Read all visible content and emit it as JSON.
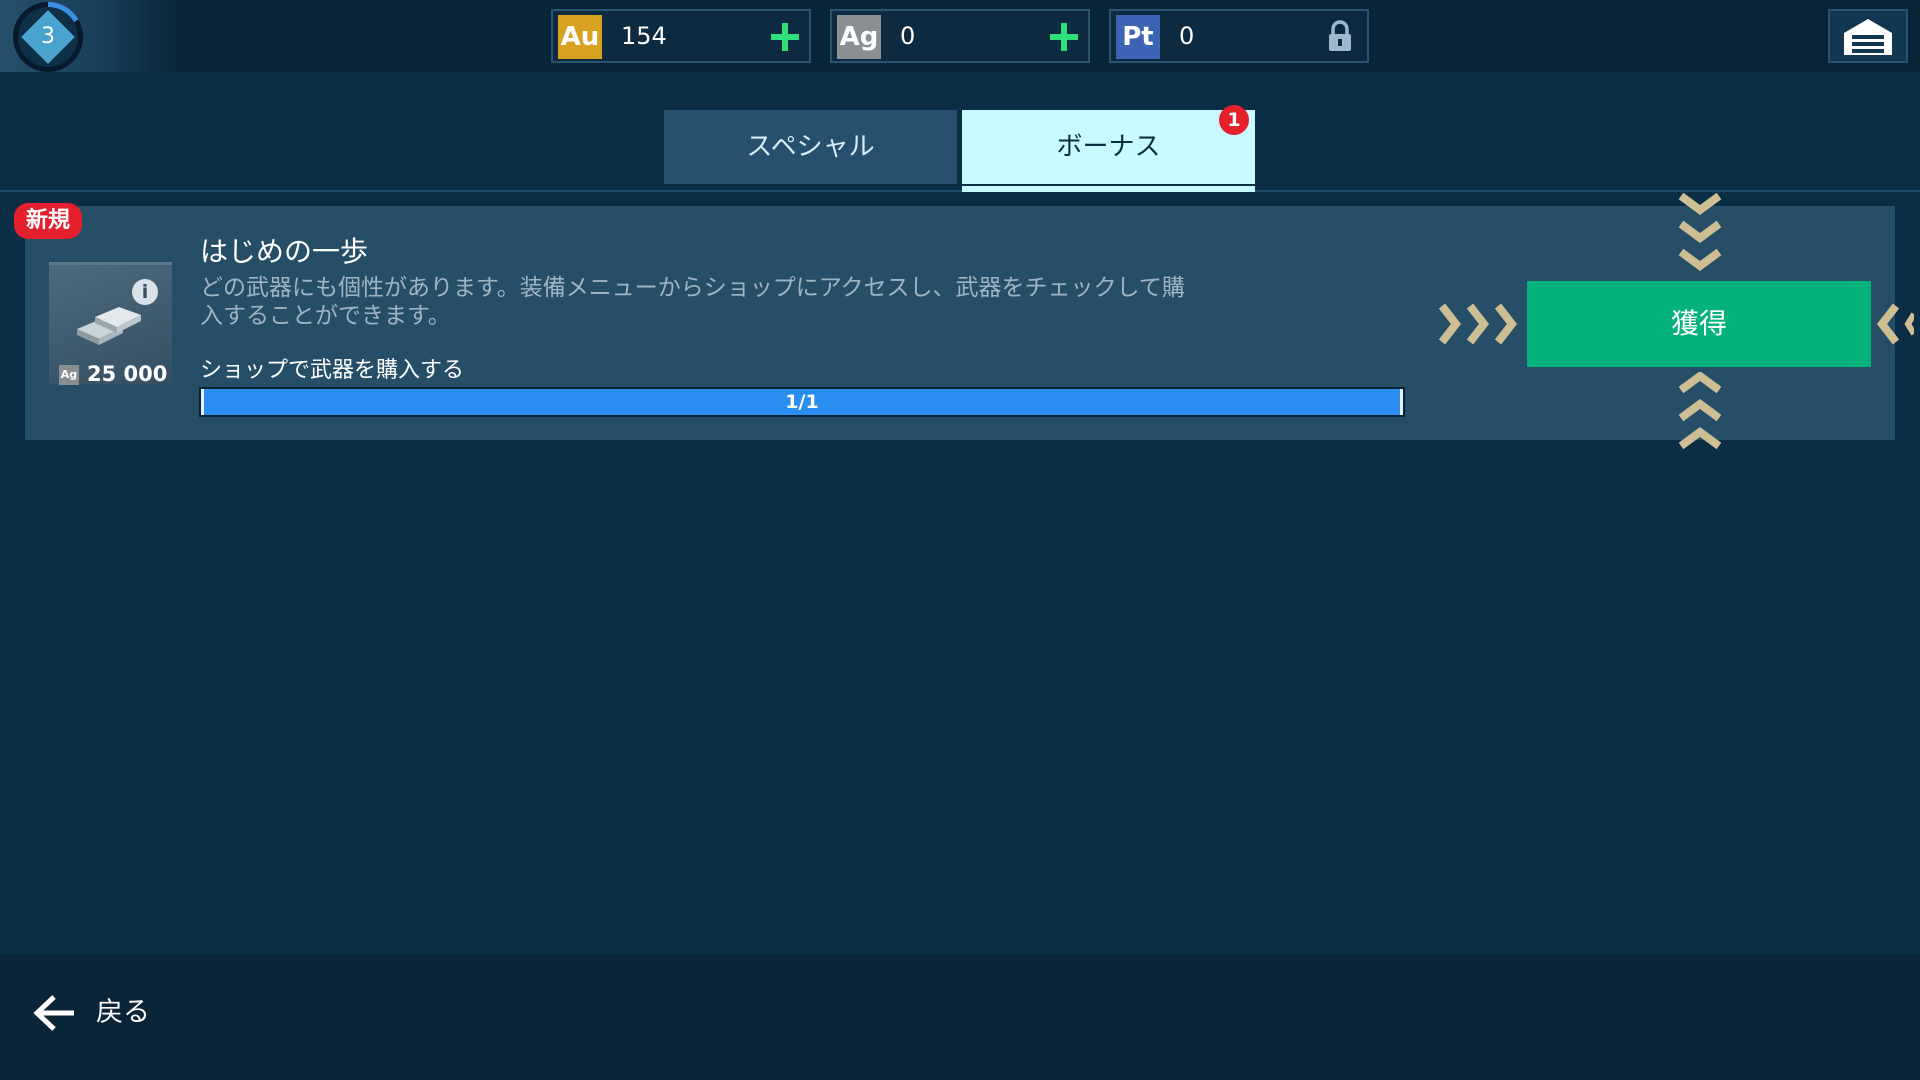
{
  "player": {
    "level": "3"
  },
  "currencies": [
    {
      "code": "Au",
      "amount": "154",
      "action": "plus-icon",
      "color": "#d6a21f"
    },
    {
      "code": "Ag",
      "amount": "0",
      "action": "plus-icon",
      "color": "#8a8f94"
    },
    {
      "code": "Pt",
      "amount": "0",
      "action": "lock-icon",
      "color": "#3c63b4"
    }
  ],
  "header": {
    "garage_icon": "garage-icon"
  },
  "tabs": [
    {
      "label": "スペシャル",
      "active": false
    },
    {
      "label": "ボーナス",
      "active": true,
      "badge": "1"
    }
  ],
  "quest": {
    "new_badge": "新規",
    "title": "はじめの一歩",
    "description_line1": "どの武器にも個性があります。装備メニューからショップにアクセスし、武器をチェックして購",
    "description_line2": "入することができます。",
    "task": "ショップで武器を購入する",
    "progress": {
      "current": 1,
      "total": 1,
      "text": "1/1"
    },
    "reward": {
      "currency": "Ag",
      "amount": "25 000",
      "info_icon": "i"
    },
    "claim_label": "獲得"
  },
  "footer": {
    "back_label": "戻る"
  }
}
